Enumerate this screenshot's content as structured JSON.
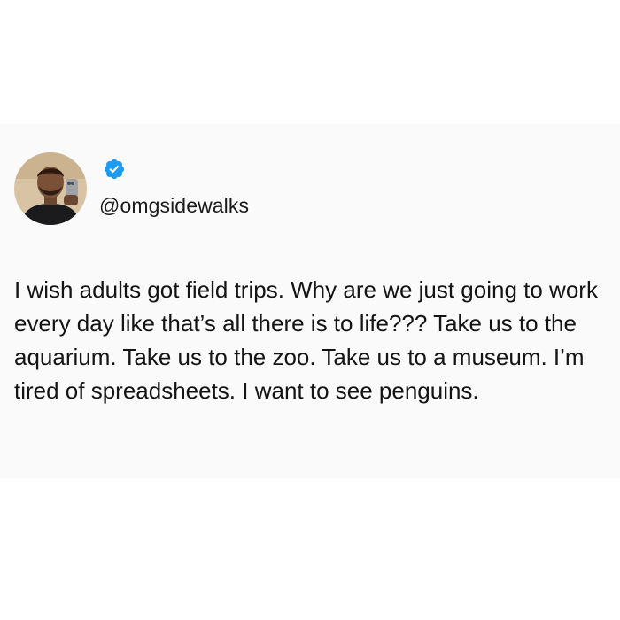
{
  "tweet": {
    "avatar_icon": "profile-photo",
    "verified_icon": "verified-checkmark-icon",
    "verified_color": "#1d9bf0",
    "handle": "@omgsidewalks",
    "text": "I wish adults got field trips. Why are we just going to work every day like that’s all there is to life??? Take us to the aquarium. Take us to the zoo. Take us to a museum. I’m tired of spreadsheets. I want to see penguins.",
    "card_background": "#fafafa",
    "page_background": "#ffffff"
  }
}
